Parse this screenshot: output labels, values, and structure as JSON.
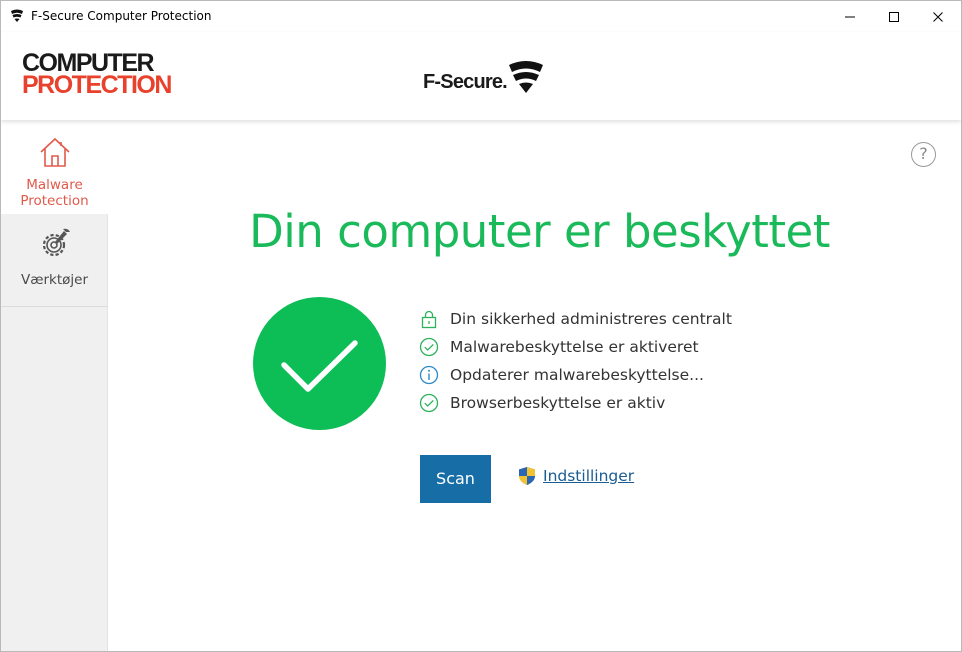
{
  "window": {
    "title": "F-Secure Computer Protection",
    "controls": [
      "minimize",
      "maximize",
      "close"
    ]
  },
  "header": {
    "product_logo_line1": "COMPUTER",
    "product_logo_line2": "PROTECTION",
    "vendor_logo_text": "F-Secure."
  },
  "sidebar": {
    "items": [
      {
        "label_line1": "Malware",
        "label_line2": "Protection",
        "icon": "home-icon",
        "active": true
      },
      {
        "label": "Værktøjer",
        "icon": "tools-icon",
        "active": false
      }
    ]
  },
  "main": {
    "help_glyph": "?",
    "headline": "Din computer er beskyttet",
    "status_items": [
      {
        "text": "Din sikkerhed administreres centralt",
        "icon": "lock-icon"
      },
      {
        "text": "Malwarebeskyttelse er aktiveret",
        "icon": "check-circle-icon"
      },
      {
        "text": "Opdaterer malwarebeskyttelse...",
        "icon": "info-icon"
      },
      {
        "text": "Browserbeskyttelse er aktiv",
        "icon": "check-circle-icon"
      }
    ],
    "scan_label": "Scan",
    "settings_label": "Indstillinger"
  },
  "colors": {
    "status_green": "#0dbd56",
    "headline_green": "#1aba5a",
    "brand_red": "#e8412c",
    "button_blue": "#176ea6",
    "link_blue": "#1b5c92"
  }
}
